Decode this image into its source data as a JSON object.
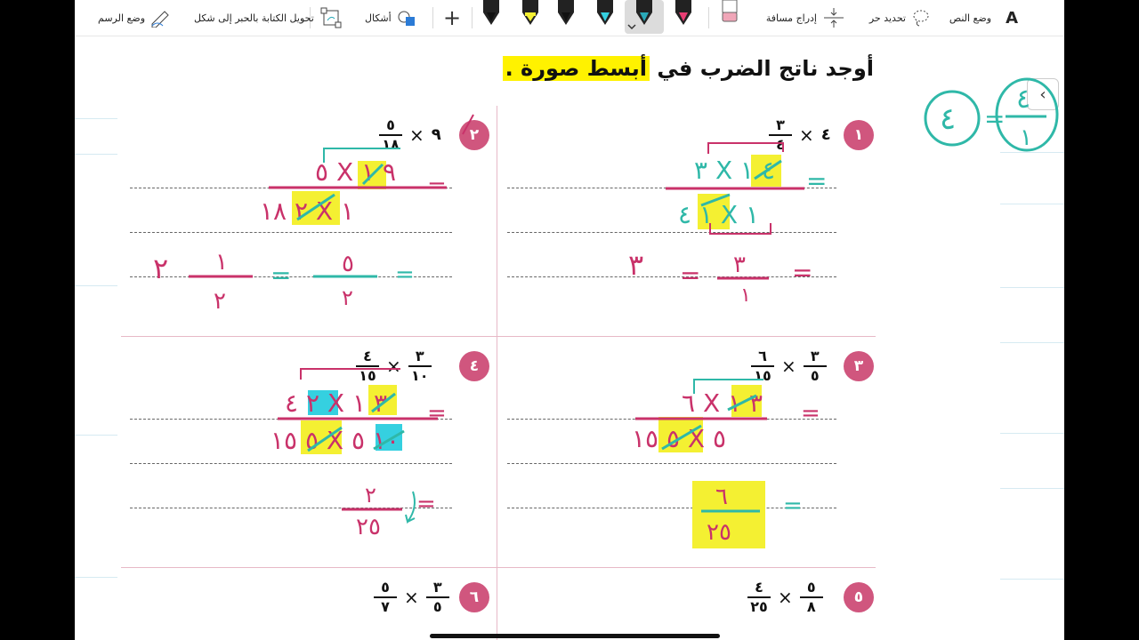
{
  "toolbar": {
    "text_mode": "وضع النص",
    "text_mode_glyph": "A",
    "lasso": "تحديد حر",
    "insert_space": "إدراج مسافة",
    "shapes": "أشكال",
    "ink_to_shape": "تحويل الكتابة بالحبر إلى شكل",
    "draw_mode": "وضع الرسم",
    "add_glyph": "+",
    "pens": [
      {
        "name": "pink-pen",
        "color": "#e83e74"
      },
      {
        "name": "teal-pen",
        "color": "#2aa9b8"
      },
      {
        "name": "black-pen",
        "color": "#222222"
      },
      {
        "name": "cyan-pen",
        "color": "#35d0e0"
      },
      {
        "name": "black-pen-2",
        "color": "#222222"
      },
      {
        "name": "yellow-highlighter",
        "color": "#f4f032"
      },
      {
        "name": "black-pen-3",
        "color": "#222222"
      }
    ],
    "eraser_color": "#f0a6b8"
  },
  "page": {
    "title_prefix": "أوجد ناتج الضرب في ",
    "title_highlight": "أبسط صورة .",
    "collapse_glyph": "‹"
  },
  "problems": [
    {
      "num": "١",
      "a_num": "٤",
      "a_den": "",
      "b_num": "٣",
      "b_den": "٤"
    },
    {
      "num": "٢",
      "a_num": "٩",
      "a_den": "",
      "b_num": "٥",
      "b_den": "١٨"
    },
    {
      "num": "٣",
      "a_num": "٣",
      "a_den": "٥",
      "b_num": "٦",
      "b_den": "١٥"
    },
    {
      "num": "٤",
      "a_num": "٣",
      "a_den": "١٠",
      "b_num": "٤",
      "b_den": "١٥"
    },
    {
      "num": "٥",
      "a_num": "٥",
      "a_den": "٨",
      "b_num": "٤",
      "b_den": "٢٥"
    },
    {
      "num": "٦",
      "a_num": "٣",
      "a_den": "٥",
      "b_num": "٥",
      "b_den": "٧"
    }
  ],
  "handwriting": {
    "side_note_1": "٤",
    "side_note_2": "٤",
    "side_note_3": "١",
    "p1_top": "٣ X ٤ ١",
    "p1_bottom": "١ ٤ X ١",
    "p1_eq": "=",
    "p1_result": "٣",
    "p1_frac_num": "٣",
    "p1_frac_den": "١",
    "p2_top": "٥ X ٩ ١",
    "p2_bottom": "٢ ١٨ X ١",
    "p2_eq": "=",
    "p2_mid_num": "٥",
    "p2_mid_den": "٢",
    "p2_res_whole": "٢",
    "p2_res_num": "١",
    "p2_res_den": "٢",
    "p3_top": "٦ X ٣ ١",
    "p3_bottom": "٥ ١٥ X ٥",
    "p3_eq": "=",
    "p3_res_num": "٦",
    "p3_res_den": "٢٥",
    "p4_top": "٢ ٤ X ٣ ١",
    "p4_bottom": "٥ ١٥ X ١٠ ٥",
    "p4_eq": "=",
    "p4_res_num": "٢",
    "p4_res_den": "٢٥"
  }
}
